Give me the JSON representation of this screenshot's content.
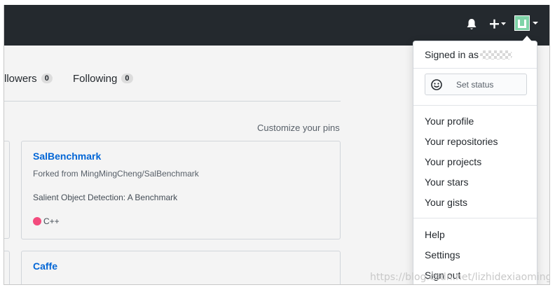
{
  "header": {
    "notifications_icon": "bell-icon",
    "create_icon": "plus-icon",
    "avatar_icon": "identicon",
    "avatar_color": "#7fd3a7",
    "bar_color": "#24292e"
  },
  "profile_tabs": {
    "followers": {
      "label": "llowers",
      "count": "0"
    },
    "following": {
      "label": "Following",
      "count": "0"
    }
  },
  "pins": {
    "customize_label": "Customize your pins",
    "repos": [
      {
        "name": "SalBenchmark",
        "fork_note": "Forked from MingMingCheng/SalBenchmark",
        "description": "Salient Object Detection: A Benchmark",
        "language": "C++",
        "language_color": "#f34b7d"
      },
      {
        "name": "Caffe"
      }
    ]
  },
  "user_menu": {
    "signed_in_prefix": "Signed in as",
    "set_status_label": "Set status",
    "set_status_icon": "smiley-icon",
    "section_profile": [
      "Your profile",
      "Your repositories",
      "Your projects",
      "Your stars",
      "Your gists"
    ],
    "section_account": [
      "Help",
      "Settings",
      "Sign out"
    ]
  },
  "watermark": "https://blog.csdn.net/lizhidexiaoming"
}
